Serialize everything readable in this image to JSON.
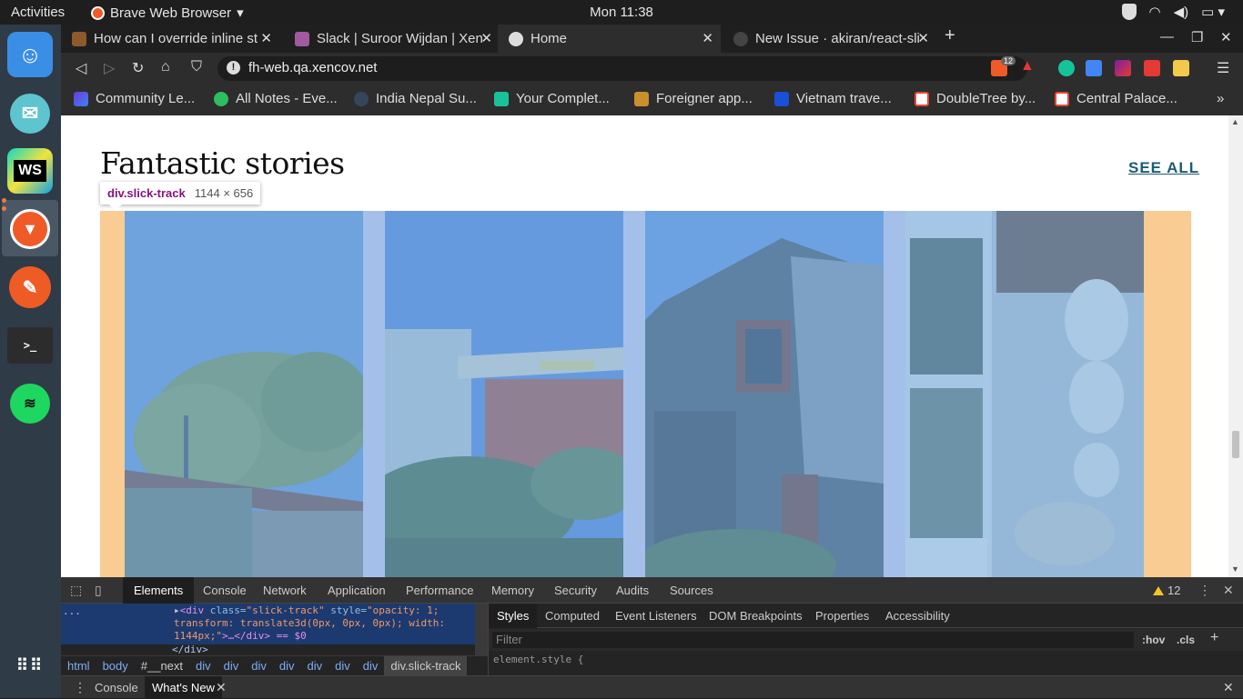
{
  "os": {
    "activities": "Activities",
    "app_name": "Brave Web Browser",
    "clock": "Mon 11:38",
    "dock_apps": [
      "finder-icon",
      "mail-icon",
      "webstorm-icon",
      "brave-icon",
      "postman-icon",
      "terminal-icon",
      "spotify-icon",
      "app-grid-icon"
    ],
    "dock_labels": {
      "webstorm": "WS",
      "terminal": ">_"
    }
  },
  "browser": {
    "tabs": [
      {
        "title": "How can I override inline st",
        "active": false
      },
      {
        "title": "Slack | Suroor Wijdan | Xen",
        "active": false
      },
      {
        "title": "Home",
        "active": true
      },
      {
        "title": "New Issue · akiran/react-sli",
        "active": false
      }
    ],
    "url": "fh-web.qa.xencov.net",
    "shield_count": "12",
    "bookmarks": [
      "Community Le...",
      "All Notes - Eve...",
      "India Nepal Su...",
      "Your Complet...",
      "Foreigner app...",
      "Vietnam trave...",
      "DoubleTree by...",
      "Central Palace..."
    ]
  },
  "page": {
    "heading": "Fantastic stories",
    "see_all": "SEE ALL",
    "tooltip": {
      "selector": "div.slick-track",
      "dims": "1144 × 656"
    },
    "slides": [
      "slide-1",
      "slide-2",
      "slide-3",
      "slide-4"
    ]
  },
  "devtools": {
    "tabs": [
      "Elements",
      "Console",
      "Network",
      "Application",
      "Performance",
      "Memory",
      "Security",
      "Audits",
      "Sources"
    ],
    "active_tab": "Elements",
    "warnings": "12",
    "code": {
      "ellipsis": "...",
      "line1_tag_open": "<div ",
      "line1_attr": "class=",
      "line1_val": "\"slick-track\"",
      "line1_attr2": " style=",
      "line1_val2": "\"opacity: 1; transform: translate3d(0px, 0px, 0px); width: 1144px;\"",
      "line1_rest": ">…</div> == $0",
      "closing": "</div>"
    },
    "breadcrumbs": [
      "html",
      "body",
      "#__next",
      "div",
      "div",
      "div",
      "div",
      "div",
      "div",
      "div",
      "div.slick-track"
    ],
    "styles_tabs": [
      "Styles",
      "Computed",
      "Event Listeners",
      "DOM Breakpoints",
      "Properties",
      "Accessibility"
    ],
    "filter_placeholder": "Filter",
    "hov": ":hov",
    "cls": ".cls",
    "rule": "element.style {",
    "drawer_tabs": [
      "Console",
      "What's New"
    ]
  }
}
